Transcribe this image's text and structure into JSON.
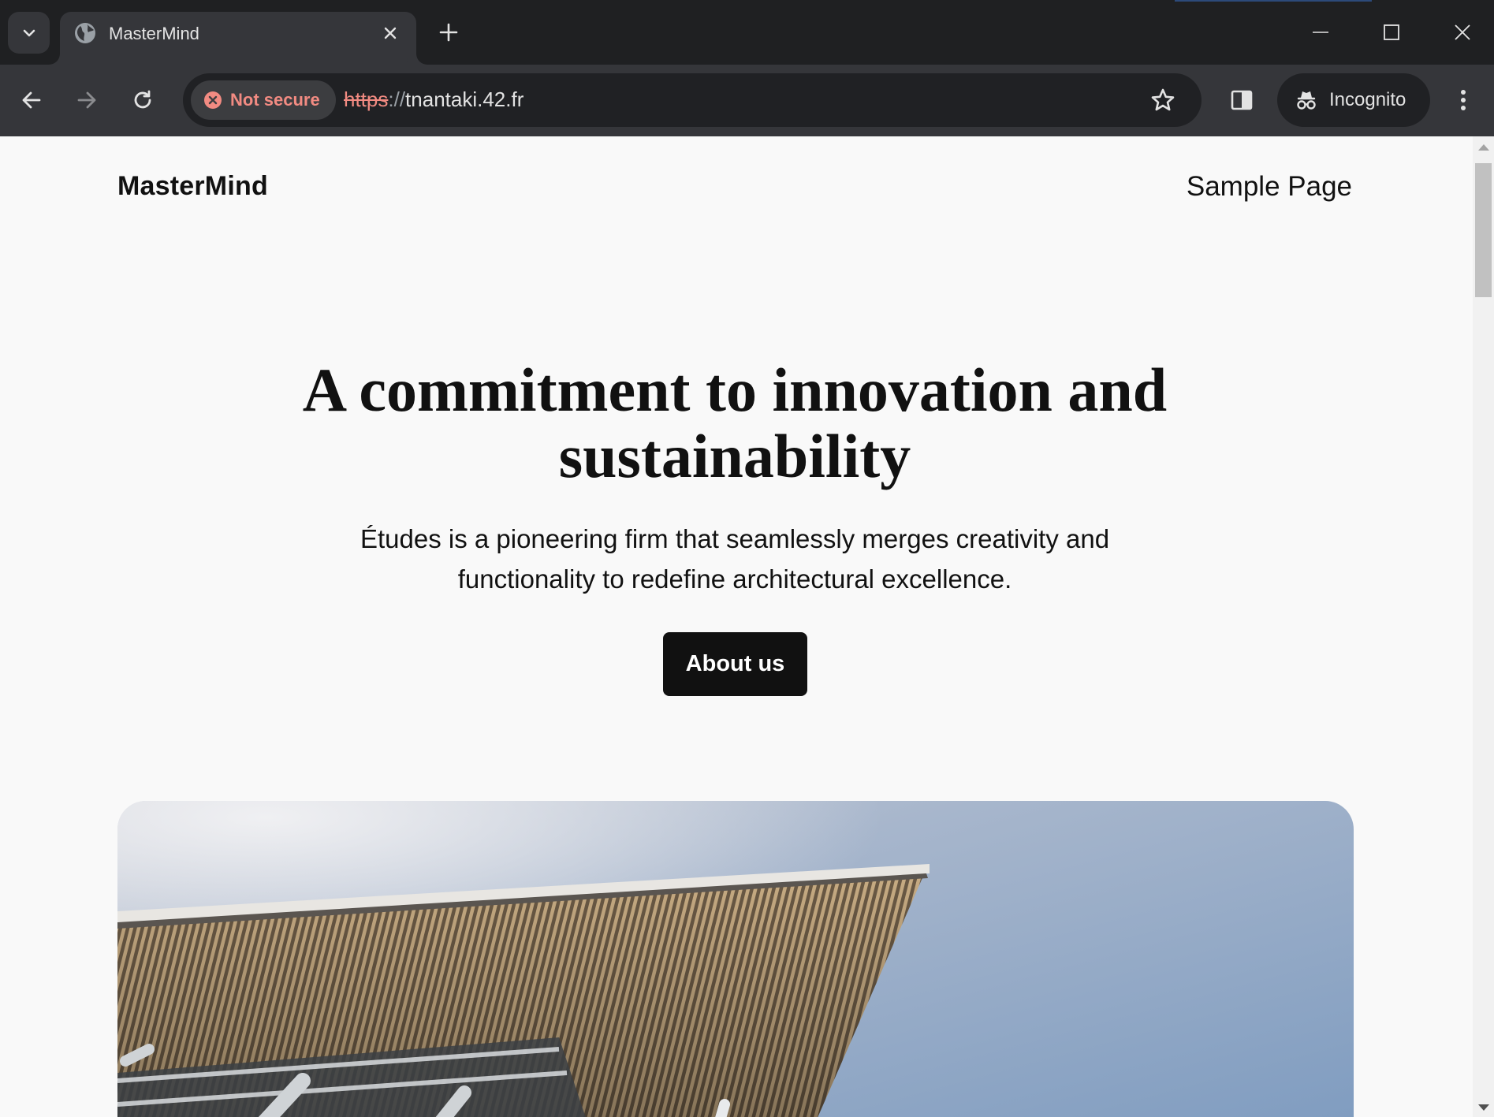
{
  "browser": {
    "tab": {
      "title": "MasterMind",
      "favicon": "globe-icon"
    },
    "new_tab_icon": "plus-icon",
    "window_controls": [
      "minimize-icon",
      "maximize-icon",
      "close-icon"
    ],
    "toolbar": {
      "security_label": "Not secure",
      "url_scheme": "https",
      "url_separator": "://",
      "url_host": "tnantaki.42.fr",
      "incognito_label": "Incognito"
    },
    "colors": {
      "frame": "#1f2022",
      "toolbar": "#35363a",
      "warning": "#f28b82"
    }
  },
  "page": {
    "site_title": "MasterMind",
    "nav": {
      "sample_page": "Sample Page"
    },
    "hero": {
      "heading": "A commitment to innovation and sustainability",
      "text": "Études is a pioneering firm that seamlessly merges creativity and functionality to redefine architectural excellence.",
      "button_label": "About us"
    },
    "image": {
      "subject": "building-canopy-photo"
    },
    "colors": {
      "background": "#f9f9f9",
      "text": "#111111",
      "button": "#111111"
    }
  }
}
